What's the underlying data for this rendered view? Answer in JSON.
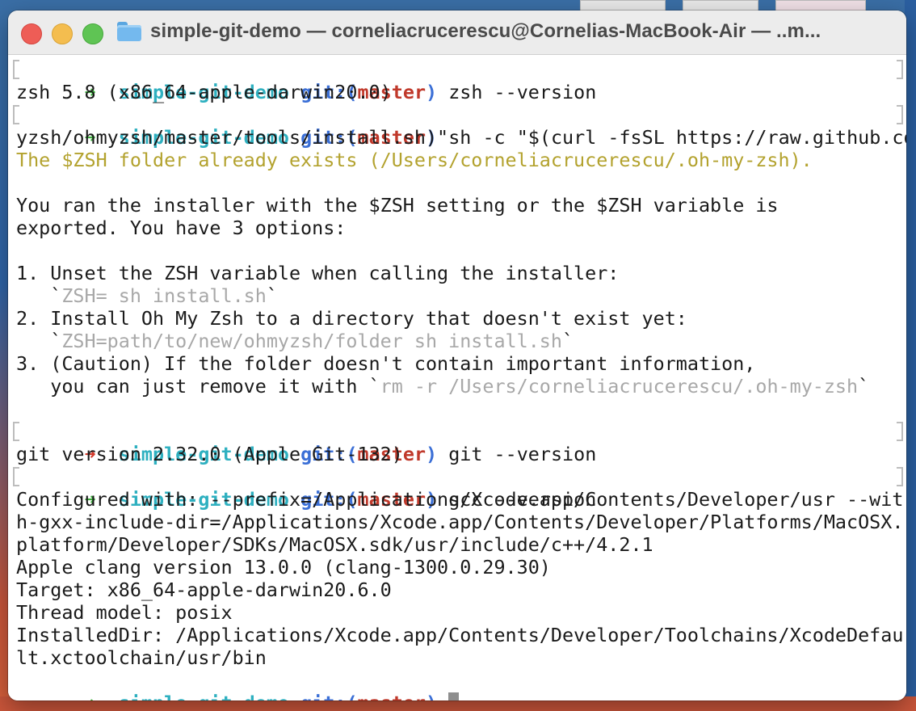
{
  "window": {
    "title": "simple-git-demo — corneliacrucerescu@Cornelias-MacBook-Air — ..m..."
  },
  "prompt": {
    "arrow": "➜",
    "dir": "simple-git-demo",
    "git_label": "git:(",
    "branch": "master",
    "close": ")"
  },
  "lines": {
    "cmd1": " zsh --version",
    "out1": "zsh 5.8 (x86_64-apple-darwin20.0)",
    "cmd2": " sh -c \"$(curl -fsSL https://raw.github.com/ohm",
    "out2a": "yzsh/ohmyzsh/master/tools/install.sh)\"",
    "warn1": "The $ZSH folder already exists (/Users/corneliacrucerescu/.oh-my-zsh).",
    "p1": "You ran the installer with the $ZSH setting or the $ZSH variable is",
    "p2": "exported. You have 3 options:",
    "o1": "1. Unset the ZSH variable when calling the installer:",
    "o1b_pre": "   `",
    "o1b_cmd": "ZSH= sh install.sh",
    "o1b_post": "`",
    "o2": "2. Install Oh My Zsh to a directory that doesn't exist yet:",
    "o2b_pre": "   `",
    "o2b_cmd": "ZSH=path/to/new/ohmyzsh/folder sh install.sh",
    "o2b_post": "`",
    "o3": "3. (Caution) If the folder doesn't contain important information,",
    "o3b_pre": "   you can just remove it with `",
    "o3b_cmd": "rm -r /Users/corneliacrucerescu/.oh-my-zsh",
    "o3b_post": "`",
    "cmd3": " git --version",
    "out3": "git version 2.32.0 (Apple Git-132)",
    "cmd4": " gcc --version",
    "g1": "Configured with: --prefix=/Applications/Xcode.app/Contents/Developer/usr --wit",
    "g2": "h-gxx-include-dir=/Applications/Xcode.app/Contents/Developer/Platforms/MacOSX.",
    "g3": "platform/Developer/SDKs/MacOSX.sdk/usr/include/c++/4.2.1",
    "g4": "Apple clang version 13.0.0 (clang-1300.0.29.30)",
    "g5": "Target: x86_64-apple-darwin20.6.0",
    "g6": "Thread model: posix",
    "g7": "InstalledDir: /Applications/Xcode.app/Contents/Developer/Toolchains/XcodeDefau",
    "g8": "lt.xctoolchain/usr/bin"
  }
}
